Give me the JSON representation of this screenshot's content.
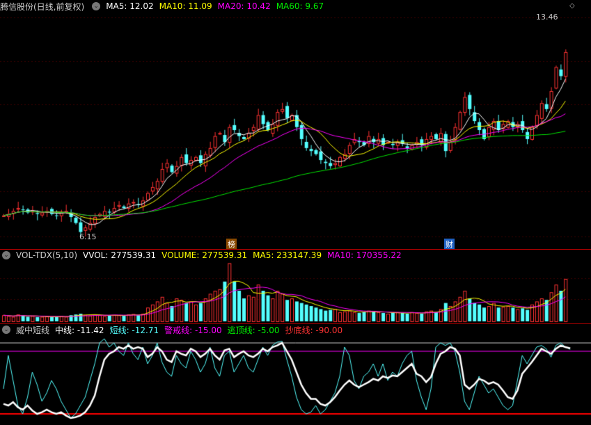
{
  "header": {
    "title": "腾信股份(日线,前复权)",
    "ma5": "MA5: 12.02",
    "ma10": "MA10: 11.09",
    "ma20": "MA20: 10.42",
    "ma60": "MA60: 9.67"
  },
  "price": {
    "high_label": "13.46",
    "low_label": "6.15",
    "marker_bang": "榜",
    "marker_cai": "财",
    "closes": [
      6.85,
      6.9,
      7.0,
      7.1,
      7.05,
      6.95,
      7.0,
      6.9,
      6.95,
      7.0,
      6.9,
      6.85,
      6.95,
      7.0,
      6.8,
      6.6,
      6.3,
      6.45,
      6.6,
      6.8,
      6.9,
      7.0,
      6.95,
      7.1,
      7.2,
      7.1,
      7.25,
      7.3,
      7.2,
      7.35,
      7.6,
      7.8,
      8.0,
      8.4,
      8.6,
      8.3,
      8.5,
      8.8,
      8.6,
      8.7,
      8.8,
      8.6,
      8.9,
      9.1,
      9.5,
      9.6,
      9.3,
      9.8,
      9.7,
      9.5,
      9.4,
      9.6,
      9.8,
      10.2,
      9.9,
      9.7,
      9.9,
      10.3,
      10.4,
      10.1,
      10.2,
      9.8,
      9.4,
      9.1,
      9.0,
      8.9,
      8.7,
      8.6,
      8.5,
      8.6,
      8.8,
      8.9,
      9.2,
      9.4,
      9.3,
      9.2,
      9.5,
      9.3,
      9.4,
      9.2,
      9.3,
      9.2,
      9.3,
      9.25,
      9.1,
      9.2,
      9.3,
      9.2,
      9.4,
      9.5,
      9.4,
      9.6,
      9.0,
      9.3,
      9.8,
      10.3,
      10.8,
      10.4,
      10.0,
      9.7,
      9.4,
      9.8,
      10.0,
      9.7,
      9.9,
      10.0,
      9.8,
      9.9,
      9.7,
      9.4,
      9.8,
      10.2,
      10.6,
      10.4,
      11.0,
      11.8,
      11.5,
      12.3
    ]
  },
  "volume": {
    "title": "VOL-TDX(5,10)",
    "vvol": "VVOL: 277539.31",
    "volume": "VOLUME: 277539.31",
    "ma5": "MA5: 233147.39",
    "ma10": "MA10: 170355.22",
    "values": [
      40,
      35,
      30,
      45,
      38,
      30,
      35,
      28,
      30,
      32,
      28,
      30,
      35,
      30,
      40,
      45,
      50,
      42,
      38,
      45,
      40,
      35,
      38,
      42,
      40,
      36,
      45,
      48,
      40,
      50,
      90,
      110,
      130,
      160,
      120,
      100,
      150,
      140,
      120,
      130,
      110,
      120,
      150,
      180,
      200,
      210,
      260,
      380,
      260,
      200,
      150,
      170,
      160,
      240,
      200,
      170,
      150,
      200,
      180,
      140,
      150,
      130,
      120,
      110,
      100,
      90,
      80,
      70,
      75,
      80,
      60,
      65,
      70,
      60,
      55,
      60,
      70,
      65,
      60,
      55,
      50,
      55,
      60,
      55,
      50,
      60,
      55,
      50,
      65,
      70,
      60,
      80,
      120,
      100,
      130,
      160,
      200,
      150,
      120,
      110,
      90,
      100,
      120,
      90,
      95,
      100,
      90,
      80,
      85,
      75,
      110,
      130,
      150,
      140,
      190,
      240,
      200,
      277.5
    ]
  },
  "osc": {
    "title": "威中短线",
    "mid": "中线: -11.42",
    "short": "短线: -12.71",
    "warn": "警戒线: -15.00",
    "top": "逃顶线: -5.00",
    "bottom": "抄底线: -90.00",
    "mid_values": [
      -78,
      -80,
      -76,
      -82,
      -85,
      -80,
      -86,
      -90,
      -88,
      -85,
      -88,
      -90,
      -88,
      -92,
      -95,
      -94,
      -92,
      -88,
      -80,
      -68,
      -45,
      -25,
      -18,
      -15,
      -10,
      -12,
      -8,
      -12,
      -10,
      -12,
      -22,
      -18,
      -10,
      -15,
      -25,
      -28,
      -15,
      -18,
      -20,
      -12,
      -15,
      -22,
      -18,
      -12,
      -20,
      -25,
      -14,
      -12,
      -22,
      -18,
      -15,
      -20,
      -22,
      -18,
      -12,
      -15,
      -10,
      -8,
      -5,
      -15,
      -25,
      -40,
      -55,
      -65,
      -72,
      -72,
      -78,
      -80,
      -76,
      -70,
      -62,
      -55,
      -50,
      -55,
      -58,
      -55,
      -52,
      -48,
      -50,
      -45,
      -47,
      -44,
      -45,
      -40,
      -35,
      -30,
      -42,
      -45,
      -52,
      -46,
      -30,
      -18,
      -15,
      -10,
      -12,
      -20,
      -55,
      -60,
      -55,
      -48,
      -50,
      -54,
      -52,
      -55,
      -62,
      -70,
      -72,
      -62,
      -42,
      -35,
      -28,
      -20,
      -12,
      -15,
      -18,
      -12,
      -8,
      -10,
      -11.42
    ],
    "short_values": [
      -60,
      -20,
      -50,
      -80,
      -90,
      -70,
      -40,
      -55,
      -75,
      -65,
      -50,
      -60,
      -75,
      -85,
      -95,
      -90,
      -80,
      -70,
      -50,
      -30,
      -5,
      0,
      -10,
      -5,
      -15,
      -20,
      -5,
      -18,
      -25,
      -10,
      -30,
      -20,
      -5,
      -28,
      -40,
      -45,
      -20,
      -30,
      -35,
      -15,
      -25,
      -40,
      -30,
      -10,
      -35,
      -45,
      -20,
      -15,
      -40,
      -30,
      -20,
      -35,
      -40,
      -25,
      -10,
      -20,
      -8,
      -4,
      -3,
      -25,
      -45,
      -70,
      -85,
      -90,
      -88,
      -80,
      -90,
      -85,
      -75,
      -65,
      -45,
      -10,
      -20,
      -50,
      -60,
      -45,
      -40,
      -30,
      -45,
      -30,
      -50,
      -40,
      -45,
      -30,
      -20,
      -15,
      -50,
      -70,
      -85,
      -60,
      -10,
      -5,
      -8,
      -5,
      -15,
      -40,
      -75,
      -85,
      -65,
      -45,
      -55,
      -65,
      -60,
      -70,
      -80,
      -85,
      -80,
      -50,
      -20,
      -30,
      -20,
      -10,
      -8,
      -12,
      -22,
      -8,
      -5,
      -10,
      -12.71
    ]
  },
  "colors": {
    "up": "#ff3232",
    "down": "#54ffff",
    "ma5": "#ffffff",
    "ma10": "#ffff00",
    "ma20": "#ff00ff",
    "ma60": "#00e600"
  }
}
